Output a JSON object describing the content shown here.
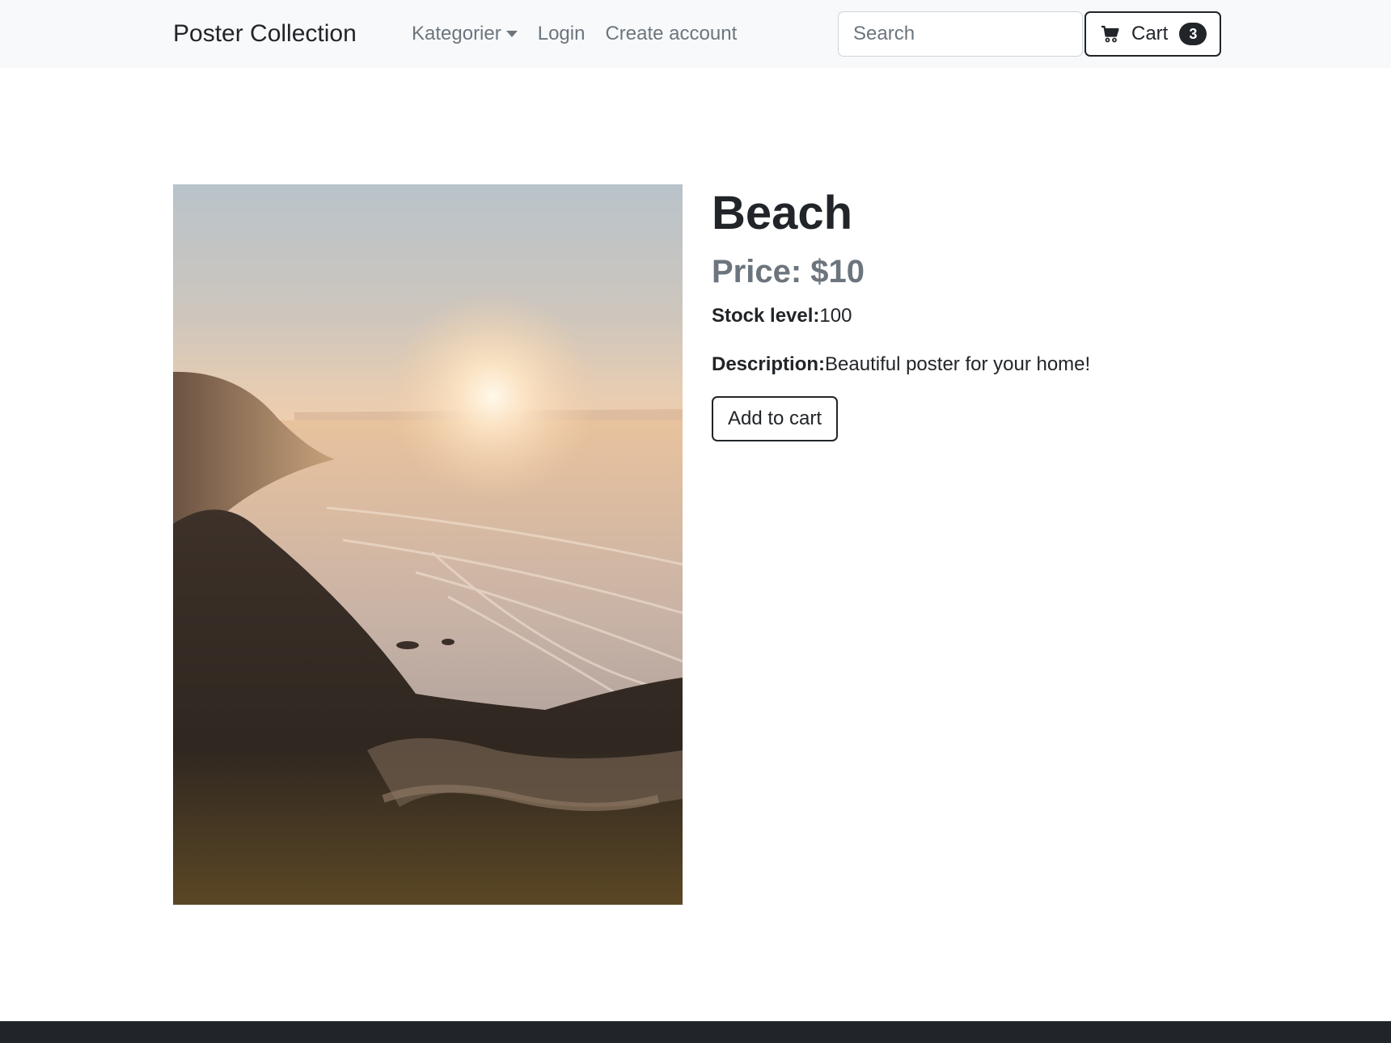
{
  "navbar": {
    "brand": "Poster Collection",
    "links": [
      {
        "label": "Kategorier"
      },
      {
        "label": "Login"
      },
      {
        "label": "Create account"
      }
    ],
    "search": {
      "placeholder": "Search",
      "value": ""
    },
    "cart": {
      "label": "Cart",
      "count": "3",
      "icon": "cart-icon"
    }
  },
  "product": {
    "title": "Beach",
    "price": "Price: $10",
    "stock_label": "Stock level:",
    "stock_value": "100",
    "description_label": "Description:",
    "description_value": "Beautiful poster for your home!",
    "add_button": "Add to cart"
  },
  "colors": {
    "navbar_bg": "#f8f9fa",
    "text": "#212529",
    "muted": "#6c757d",
    "footer_bg": "#212529"
  }
}
